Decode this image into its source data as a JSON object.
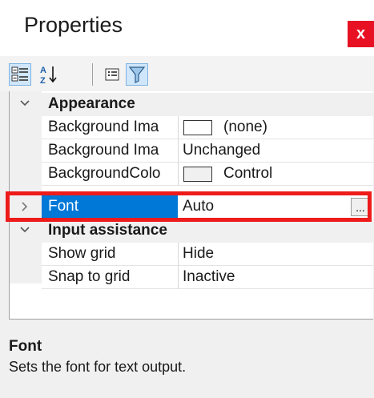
{
  "window": {
    "title": "Properties",
    "close_label": "x"
  },
  "toolbar": {
    "buttons": [
      {
        "name": "categorized",
        "icon": "categorized-icon",
        "active": true
      },
      {
        "name": "alphabetical",
        "icon": "sort-az-icon",
        "active": false
      },
      {
        "name": "property-pages",
        "icon": "property-pages-icon",
        "active": false
      },
      {
        "name": "filter",
        "icon": "filter-icon",
        "active": true
      }
    ]
  },
  "categories": [
    {
      "label": "Appearance",
      "expanded": true,
      "properties": [
        {
          "name": "Background Ima",
          "value": "(none)",
          "swatch": "#ffffff"
        },
        {
          "name": "Background Ima",
          "value": "Unchanged"
        },
        {
          "name": "BackgroundColo",
          "value": "Control",
          "swatch": "#f0f0f0"
        }
      ]
    },
    {
      "label": "Input assistance",
      "expanded": true,
      "properties": [
        {
          "name": "Show grid",
          "value": "Hide"
        },
        {
          "name": "Snap to grid",
          "value": "Inactive"
        }
      ]
    }
  ],
  "selected_property": {
    "name": "Font",
    "value": "Auto",
    "button_label": "..."
  },
  "description": {
    "title": "Font",
    "text": "Sets the font for text output."
  },
  "colors": {
    "selection": "#0078d7",
    "highlight_box": "#ee1b1b",
    "close_button": "#e81123"
  }
}
